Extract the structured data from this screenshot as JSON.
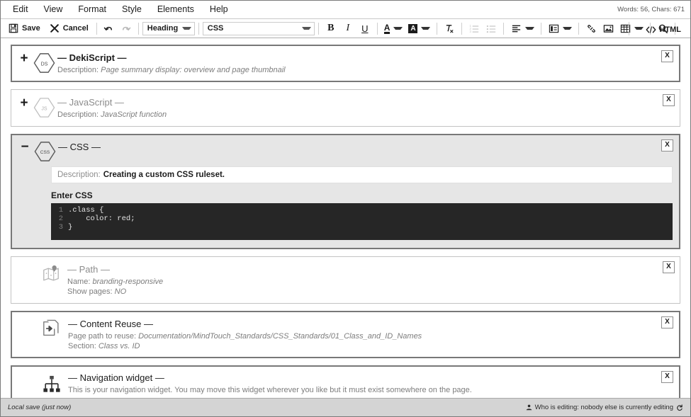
{
  "window": {
    "wordcount": "Words: 56, Chars: 671"
  },
  "menubar": {
    "items": [
      {
        "label": "Edit",
        "name": "menu-edit"
      },
      {
        "label": "View",
        "name": "menu-view"
      },
      {
        "label": "Format",
        "name": "menu-format"
      },
      {
        "label": "Style",
        "name": "menu-style"
      },
      {
        "label": "Elements",
        "name": "menu-elements"
      },
      {
        "label": "Help",
        "name": "menu-help"
      }
    ]
  },
  "toolbar": {
    "save_label": "Save",
    "cancel_label": "Cancel",
    "undo_icon": "undo-icon",
    "redo_icon": "redo-icon",
    "heading_select": "Heading",
    "style_select": "CSS",
    "bold_label": "B",
    "italic_label": "I",
    "underline_label": "U",
    "textcolor_label": "A",
    "highlight_label": "A",
    "clearformat_label": "Ix",
    "numbered_list_icon": "numbered-list-icon",
    "bullet_list_icon": "bullet-list-icon",
    "align_icon": "align-left-icon",
    "indent_icon": "indent-icon",
    "link_icon": "link-icon",
    "image_icon": "image-icon",
    "table_icon": "table-icon",
    "search_icon": "search-icon",
    "html_label": "HTML",
    "html_icon": "code-brackets-icon"
  },
  "widgets": [
    {
      "name": "dekiscript",
      "toggle": "+",
      "state": "collapsed",
      "active": true,
      "icon": "hexagon-icon",
      "icon_text": "DS",
      "title": "— DekiScript —",
      "rows": [
        {
          "label": "Description:",
          "value": "Page summary display: overview and page thumbnail"
        }
      ],
      "close_label": "X"
    },
    {
      "name": "javascript",
      "toggle": "+",
      "state": "collapsed",
      "active": false,
      "icon": "hexagon-icon",
      "icon_text": "JS",
      "title": "— JavaScript —",
      "rows": [
        {
          "label": "Description:",
          "value": "JavaScript function"
        }
      ],
      "close_label": "X"
    }
  ],
  "css_widget": {
    "name": "css",
    "toggle": "−",
    "icon": "hexagon-icon",
    "icon_text": "CSS",
    "title": "— CSS —",
    "description_label": "Description:",
    "description_value": "Creating a custom CSS ruleset.",
    "enter_label": "Enter CSS",
    "code_lines": [
      {
        "num": "1",
        "text": ".class {"
      },
      {
        "num": "2",
        "text": "    color: red;"
      },
      {
        "num": "3",
        "text": "}"
      }
    ],
    "close_label": "X"
  },
  "widgets2": [
    {
      "name": "path",
      "active": false,
      "icon": "map-pin-icon",
      "title": "— Path —",
      "rows": [
        {
          "label": "Name:",
          "value": "branding-responsive"
        },
        {
          "label": "Show pages:",
          "value": "NO"
        }
      ],
      "close_label": "X"
    },
    {
      "name": "content-reuse",
      "active": true,
      "icon": "content-reuse-icon",
      "title": "— Content Reuse —",
      "rows": [
        {
          "label": "Page path to reuse:",
          "value": "Documentation/MindTouch_Standards/CSS_Standards/01_Class_and_ID_Names"
        },
        {
          "label": "Section:",
          "value": "Class vs. ID"
        }
      ],
      "close_label": "X"
    },
    {
      "name": "navigation-widget",
      "active": true,
      "icon": "sitemap-icon",
      "title": "— Navigation widget —",
      "rows": [
        {
          "label": "",
          "value": "This is your navigation widget. You may move this widget wherever you like but it must exist somewhere on the page."
        }
      ],
      "close_label": "X"
    }
  ],
  "statusbar": {
    "left": "Local save (just now)",
    "person_icon": "person-icon",
    "right": "Who is editing: nobody else is currently editing",
    "refresh_icon": "refresh-icon"
  },
  "colors": {
    "border_active": "#787878",
    "border_inactive": "#c3c3c3",
    "expanded_bg": "#e6e6e6",
    "code_bg": "#262626",
    "statusbar_bg": "#d4d4d4"
  }
}
